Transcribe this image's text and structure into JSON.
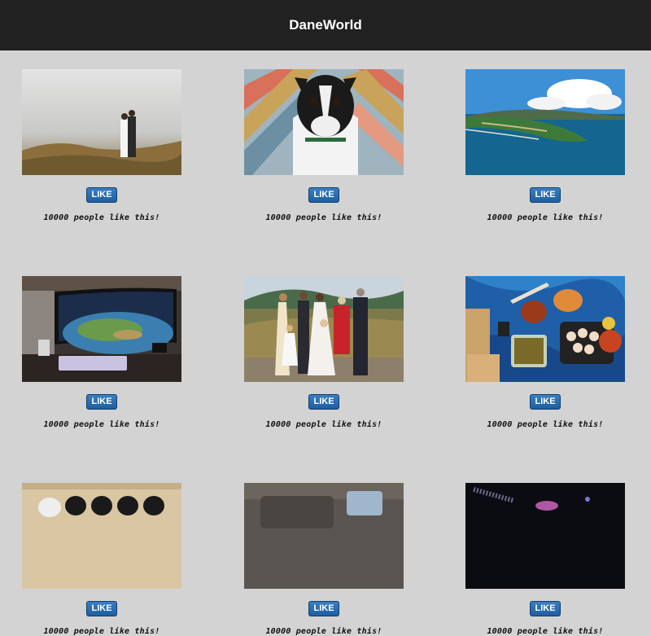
{
  "header": {
    "title": "DaneWorld"
  },
  "photos": [
    {
      "alt": "wedding-couple-fog",
      "like_label": "LIKE",
      "like_text": "10000 people like this!"
    },
    {
      "alt": "boston-terrier-dog",
      "like_label": "LIKE",
      "like_text": "10000 people like this!"
    },
    {
      "alt": "aerial-island-coast",
      "like_label": "LIKE",
      "like_text": "10000 people like this!"
    },
    {
      "alt": "curved-monitor-desk",
      "like_label": "LIKE",
      "like_text": "10000 people like this!"
    },
    {
      "alt": "family-wedding-group",
      "like_label": "LIKE",
      "like_text": "10000 people like this!"
    },
    {
      "alt": "picnic-food-blanket",
      "like_label": "LIKE",
      "like_text": "10000 people like this!"
    },
    {
      "alt": "shoes-on-floor",
      "like_label": "LIKE",
      "like_text": "10000 people like this!"
    },
    {
      "alt": "sofa-cushions",
      "like_label": "LIKE",
      "like_text": "10000 people like this!"
    },
    {
      "alt": "dark-night-scene",
      "like_label": "LIKE",
      "like_text": "10000 people like this!"
    }
  ]
}
